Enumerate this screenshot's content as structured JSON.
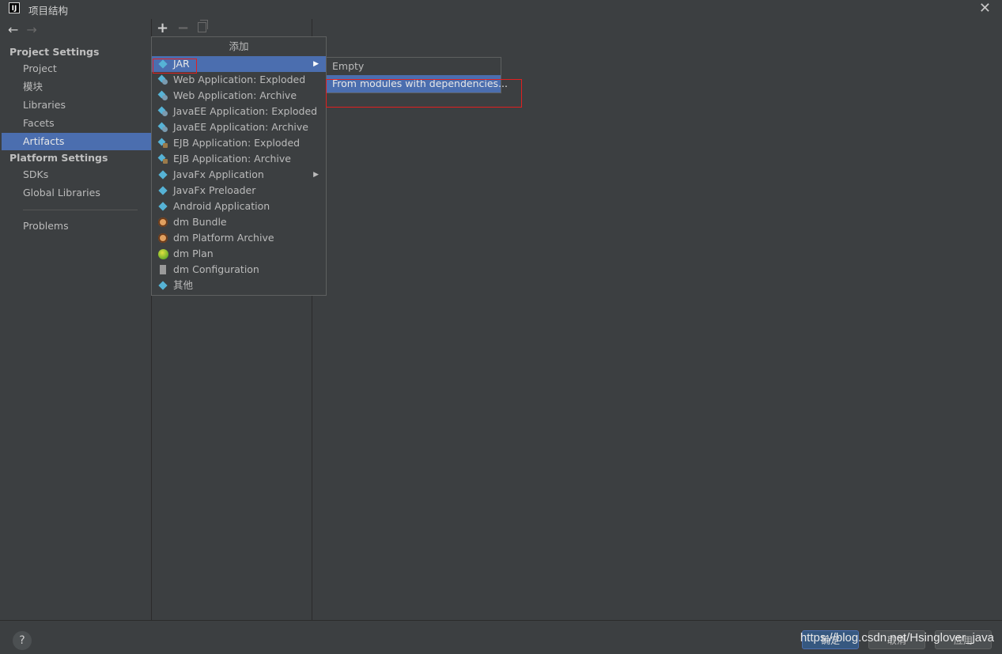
{
  "window": {
    "icon_text": "IJ",
    "title": "项目结构",
    "close_glyph": "✕"
  },
  "nav": {
    "back_glyph": "←",
    "forward_glyph": "→"
  },
  "sidebar": {
    "project_settings_label": "Project Settings",
    "project_items": [
      {
        "label": "Project"
      },
      {
        "label": "模块"
      },
      {
        "label": "Libraries"
      },
      {
        "label": "Facets"
      },
      {
        "label": "Artifacts",
        "selected": true
      }
    ],
    "platform_settings_label": "Platform Settings",
    "platform_items": [
      {
        "label": "SDKs"
      },
      {
        "label": "Global Libraries"
      }
    ],
    "problems_label": "Problems"
  },
  "toolbar": {
    "add_glyph": "+",
    "remove_glyph": "−"
  },
  "popup": {
    "title": "添加",
    "items": [
      {
        "label": "JAR",
        "icon": "artifact-diamond-icon",
        "selected": true,
        "submenu": true
      },
      {
        "label": "Web Application: Exploded",
        "icon": "web-artifact-icon"
      },
      {
        "label": "Web Application: Archive",
        "icon": "web-artifact-icon"
      },
      {
        "label": "JavaEE Application: Exploded",
        "icon": "javaee-artifact-icon"
      },
      {
        "label": "JavaEE Application: Archive",
        "icon": "javaee-artifact-icon"
      },
      {
        "label": "EJB Application: Exploded",
        "icon": "ejb-artifact-icon"
      },
      {
        "label": "EJB Application: Archive",
        "icon": "ejb-artifact-icon"
      },
      {
        "label": "JavaFx Application",
        "icon": "artifact-diamond-icon",
        "submenu": true
      },
      {
        "label": "JavaFx Preloader",
        "icon": "artifact-diamond-icon"
      },
      {
        "label": "Android Application",
        "icon": "artifact-diamond-icon"
      },
      {
        "label": "dm Bundle",
        "icon": "dm-bundle-icon"
      },
      {
        "label": "dm Platform Archive",
        "icon": "dm-bundle-icon"
      },
      {
        "label": "dm Plan",
        "icon": "dm-plan-icon"
      },
      {
        "label": "dm Configuration",
        "icon": "dm-config-icon"
      },
      {
        "label": "其他",
        "icon": "artifact-diamond-icon"
      }
    ],
    "submenu_arrow_glyph": "▶"
  },
  "submenu": {
    "items": [
      {
        "label": "Empty"
      },
      {
        "label": "From modules with dependencies...",
        "selected": true
      }
    ]
  },
  "footer": {
    "help_glyph": "?",
    "ok_label": "确定",
    "cancel_label": "取消",
    "apply_label": "应用",
    "watermark": "https://blog.csdn.net/Hsinglover_java"
  },
  "colors": {
    "selection": "#4b6eaf",
    "background": "#3c3f41",
    "highlight_box": "#e02020"
  }
}
